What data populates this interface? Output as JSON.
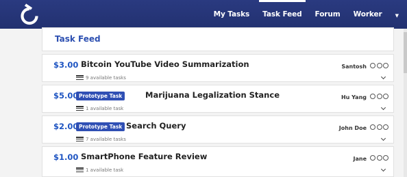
{
  "nav": {
    "items": [
      "My Tasks",
      "Task Feed",
      "Forum",
      "Worker"
    ],
    "active": "Task Feed",
    "dropdown_glyph": "▼"
  },
  "panel": {
    "title": "Task Feed"
  },
  "tasks": [
    {
      "price": "$3.00",
      "badge": "",
      "title": "Bitcoin YouTube Video Summarization",
      "available": "9 available tasks",
      "owner": "Santosh"
    },
    {
      "price": "$5.00",
      "badge": "Prototype Task",
      "title": "Marijuana Legalization Stance",
      "available": "1 available task",
      "owner": "Hu Yang"
    },
    {
      "price": "$2.00",
      "badge": "Prototype Task",
      "title": "Search Query",
      "available": "7 available tasks",
      "owner": "John Doe"
    },
    {
      "price": "$1.00",
      "badge": "",
      "title": "SmartPhone Feature Review",
      "available": "1 available task",
      "owner": "Jane"
    }
  ],
  "icons": {
    "logo": "logo-icon",
    "list": "list-icon",
    "rating": "rating-circle-icon",
    "expand": "chevron-down-icon"
  },
  "colors": {
    "navbar": "#223170",
    "accent": "#1f55c2",
    "badge": "#2f4fb4"
  }
}
